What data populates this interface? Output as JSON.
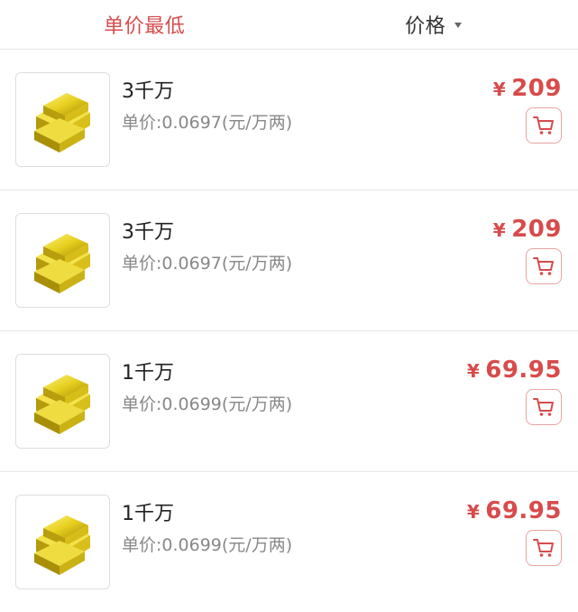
{
  "tabs": [
    {
      "label": "单价最低",
      "active": true
    },
    {
      "label": "价格",
      "active": false
    }
  ],
  "currency_symbol": "¥",
  "colors": {
    "accent": "#d84b4b",
    "cart_border": "#e9a3a3"
  },
  "items": [
    {
      "title": "3千万",
      "unit_price": "单价:0.0697(元/万两)",
      "price": "209",
      "image_icon": "gold-bars-icon",
      "cart_icon": "cart-icon"
    },
    {
      "title": "3千万",
      "unit_price": "单价:0.0697(元/万两)",
      "price": "209",
      "image_icon": "gold-bars-icon",
      "cart_icon": "cart-icon"
    },
    {
      "title": "1千万",
      "unit_price": "单价:0.0699(元/万两)",
      "price": "69.95",
      "image_icon": "gold-bars-icon",
      "cart_icon": "cart-icon"
    },
    {
      "title": "1千万",
      "unit_price": "单价:0.0699(元/万两)",
      "price": "69.95",
      "image_icon": "gold-bars-icon",
      "cart_icon": "cart-icon"
    }
  ]
}
